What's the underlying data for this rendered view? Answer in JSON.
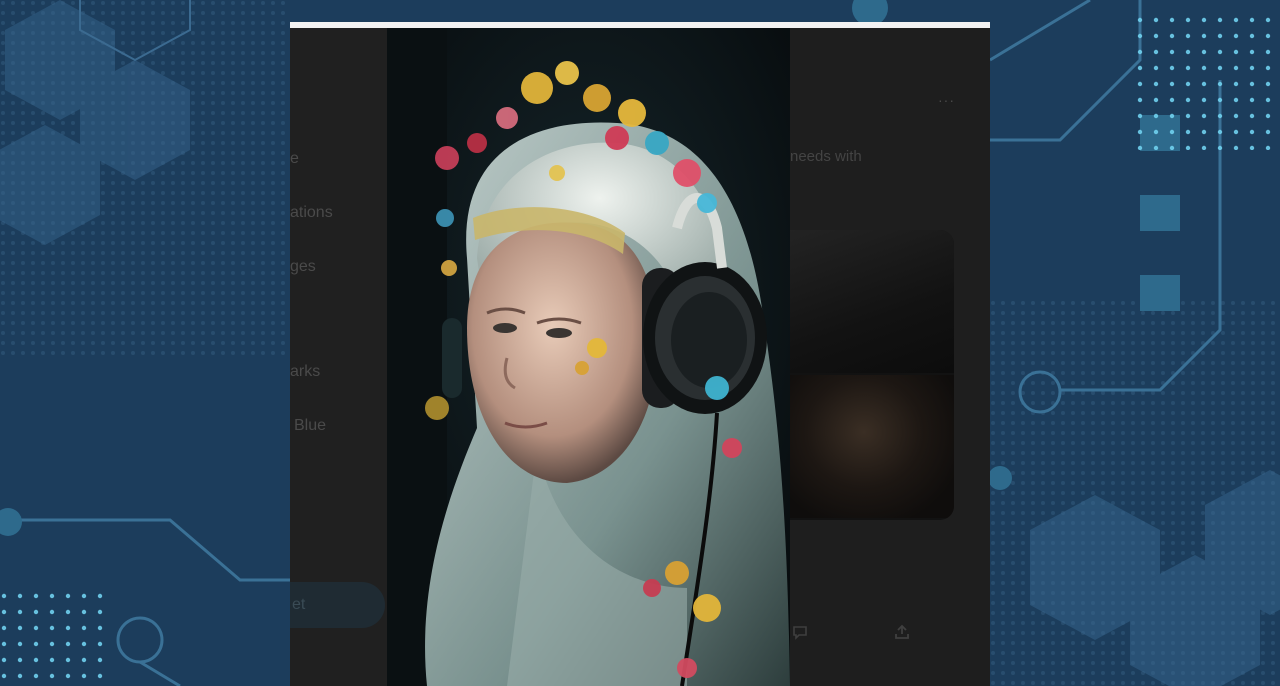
{
  "sidebar": {
    "items": [
      {
        "label": "e"
      },
      {
        "label": "ations"
      },
      {
        "label": "ges"
      },
      {
        "label": "arks"
      },
      {
        "label": "Blue"
      }
    ],
    "post_button_label": "et"
  },
  "post": {
    "text": "needs with",
    "more_label": "···"
  },
  "icons": {
    "reply": "chat-bubble-icon",
    "share": "share-icon"
  },
  "colors": {
    "background": "#1c3d5c",
    "sidebar": "#202020",
    "dim_overlay": "#1a1a1a"
  }
}
